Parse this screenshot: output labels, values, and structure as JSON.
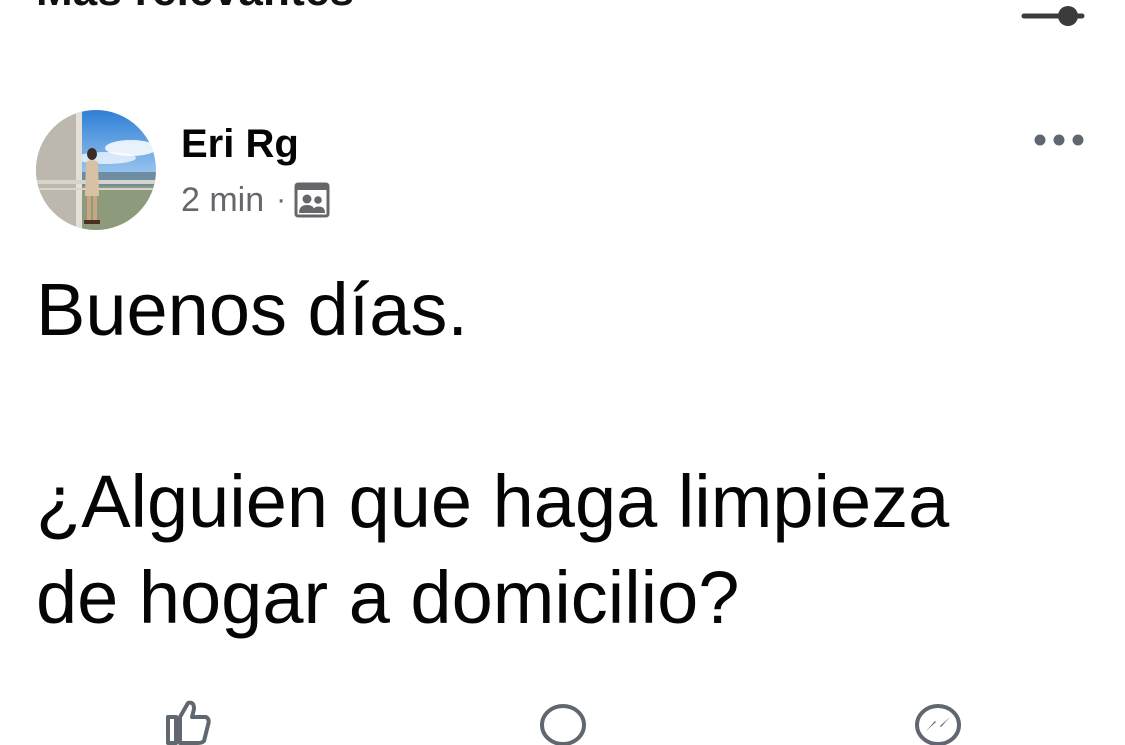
{
  "section": {
    "title": "Más relevantes",
    "sort_icon": "slider-toggle-icon"
  },
  "post": {
    "author": {
      "name": "Eri Rg",
      "avatar_icon": "profile-photo"
    },
    "time": "2 min",
    "separator": "·",
    "audience_icon": "group-members-icon",
    "more_icon": "more-horizontal-icon",
    "body": {
      "line1": "Buenos días.",
      "line2": "¿Alguien que haga limpieza",
      "line3": "de hogar a domicilio?"
    }
  },
  "actions": [
    {
      "icon": "like-icon"
    },
    {
      "icon": "comment-icon"
    },
    {
      "icon": "messenger-share-icon"
    }
  ],
  "colors": {
    "primary_text": "#050505",
    "secondary_text": "#65676b",
    "icon": "#606770"
  }
}
